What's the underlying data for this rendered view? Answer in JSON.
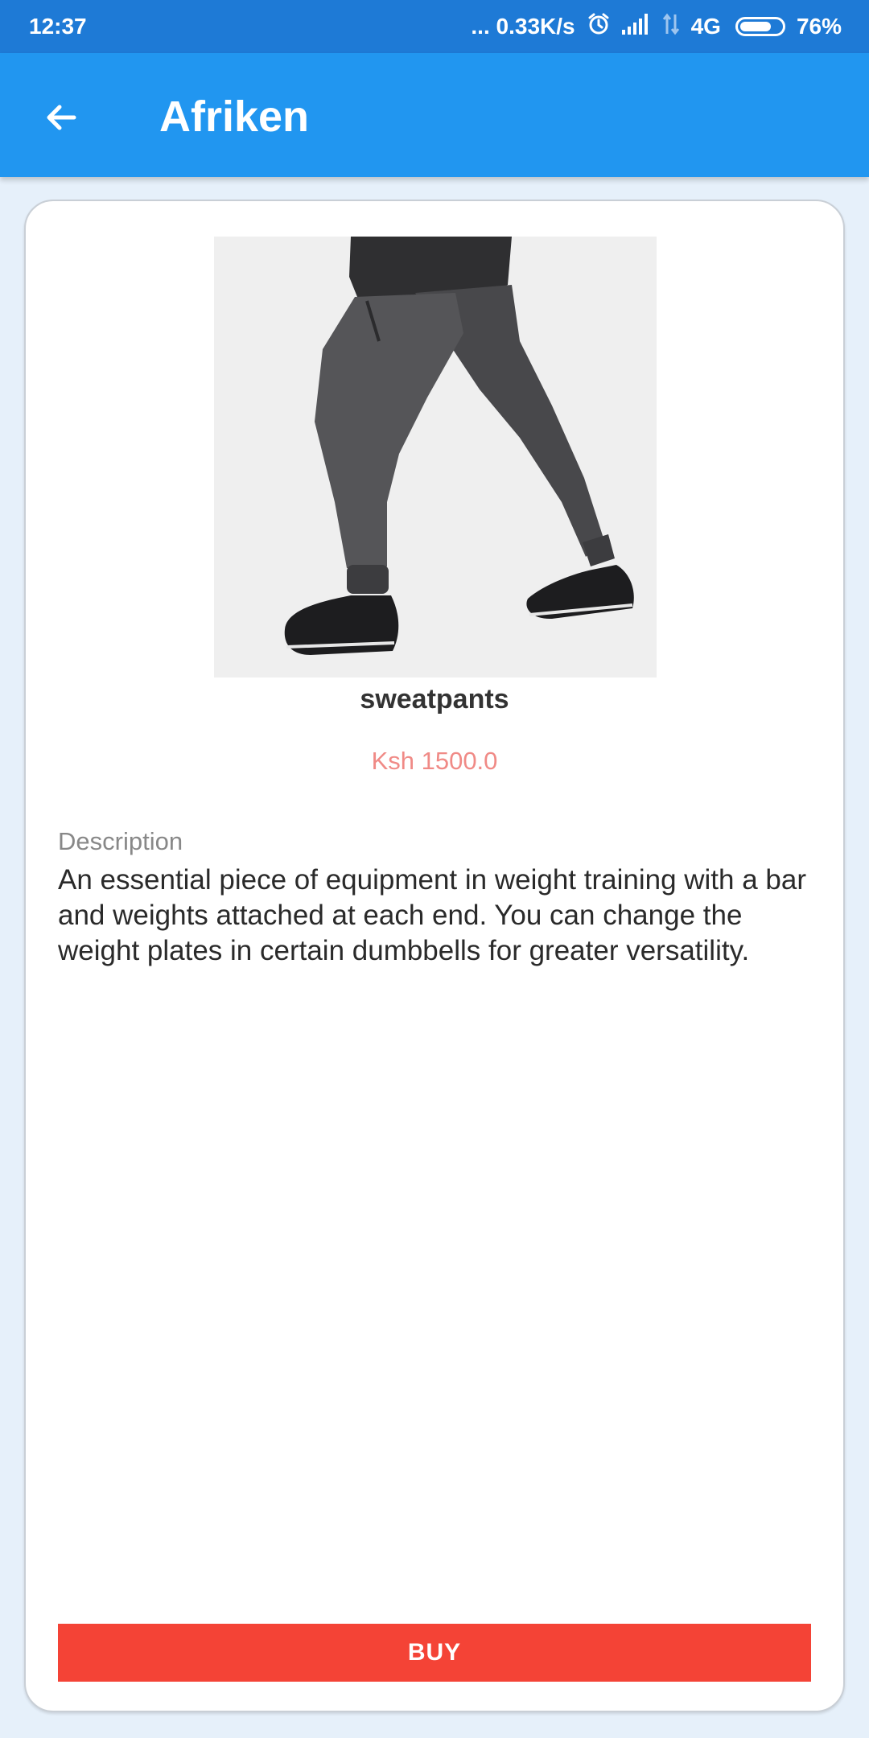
{
  "status_bar": {
    "time": "12:37",
    "network_speed": "... 0.33K/s",
    "network_type": "4G",
    "battery": "76%",
    "battery_level": 0.76
  },
  "app_bar": {
    "title": "Afriken",
    "back_icon": "arrow-left-icon"
  },
  "product": {
    "image_description": "model wearing dark grey jogger sweatpants and black sneakers",
    "name": "sweatpants",
    "price": "Ksh 1500.0",
    "description_label": "Description",
    "description": "An essential piece of equipment in weight training with a bar and weights attached at each end. You can change the weight plates in certain dumbbells for greater versatility."
  },
  "actions": {
    "buy_label": "BUY"
  },
  "colors": {
    "status_bar": "#1e7ad6",
    "app_bar": "#2196f0",
    "background": "#e6f0fa",
    "price": "#f08a86",
    "buy_button": "#f44336"
  }
}
